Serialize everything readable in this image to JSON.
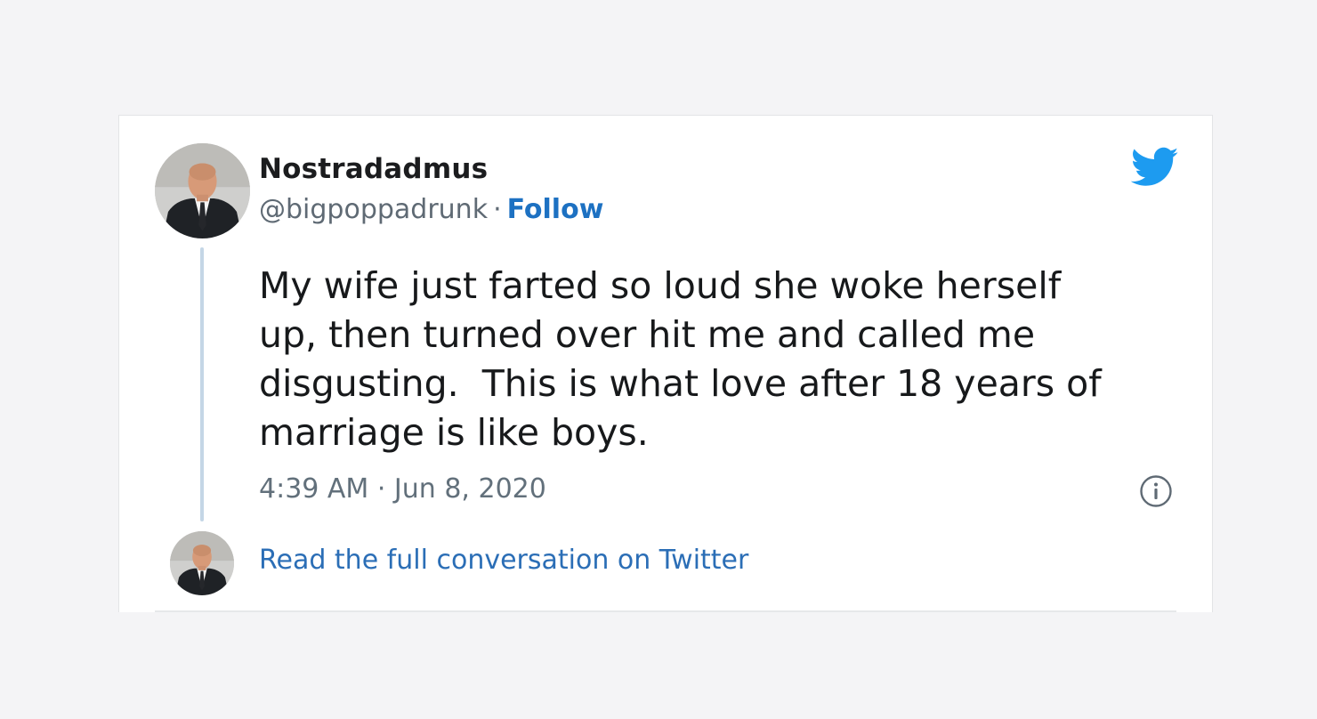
{
  "tweet": {
    "author": {
      "display_name": "Nostradadmus",
      "handle": "@bigpoppadrunk",
      "avatar_icon": "profile-photo"
    },
    "follow_separator": "·",
    "follow_label": "Follow",
    "text": "My wife just farted so loud she woke herself\nup, then turned over hit me and called me\ndisgusting.  This is what love after 18 years of\nmarriage is like boys.",
    "timestamp": "4:39 AM · Jun 8, 2020",
    "read_full_label": "Read the full conversation on Twitter",
    "icons": {
      "brand": "twitter-bird-icon",
      "info": "info-icon"
    }
  },
  "colors": {
    "page_background": "#f4f4f6",
    "card_background": "#ffffff",
    "twitter_blue": "#1d9bf0",
    "link_blue": "#1d71c2",
    "thread_line": "#c4d6e6"
  }
}
